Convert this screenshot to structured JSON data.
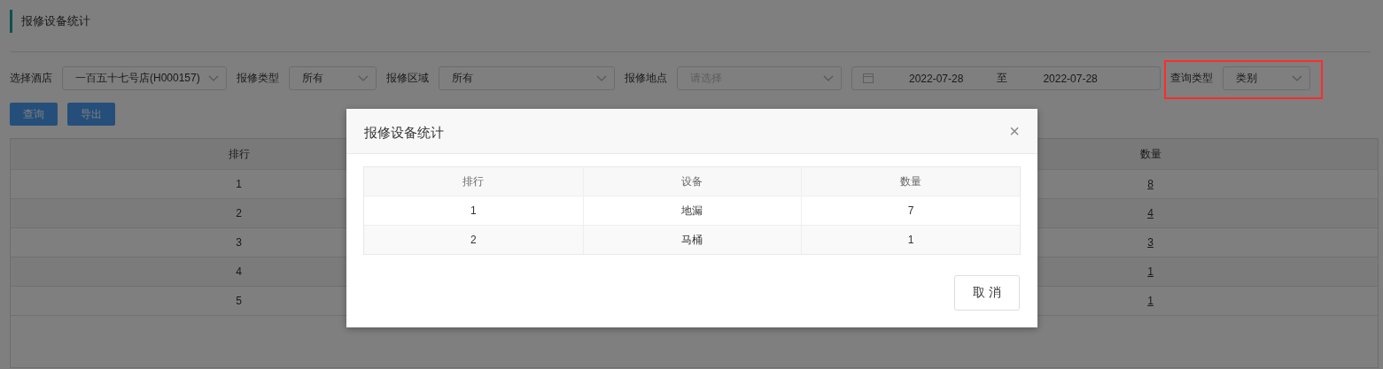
{
  "page": {
    "title": "报修设备统计"
  },
  "filters": [
    {
      "kind": "select",
      "label": "选择酒店",
      "value": "一百五十七号店(H000157)",
      "highlighted": false
    },
    {
      "kind": "select",
      "label": "报修类型",
      "value": "所有",
      "highlighted": false
    },
    {
      "kind": "select",
      "label": "报修区域",
      "value": "所有",
      "highlighted": false
    },
    {
      "kind": "select",
      "label": "报修地点",
      "placeholder": "请选择",
      "highlighted": false
    },
    {
      "kind": "daterange",
      "start": "2022-07-28",
      "separator": "至",
      "end": "2022-07-28",
      "highlighted": false
    },
    {
      "kind": "select",
      "label": "查询类型",
      "value": "类别",
      "highlighted": true
    }
  ],
  "buttons": [
    "查询",
    "导出"
  ],
  "table": {
    "columns": [
      "排行",
      "数量"
    ],
    "rows": [
      {
        "rank": "1",
        "count": "8"
      },
      {
        "rank": "2",
        "count": "4"
      },
      {
        "rank": "3",
        "count": "3"
      },
      {
        "rank": "4",
        "count": "1"
      },
      {
        "rank": "5",
        "count": "1"
      }
    ]
  },
  "dialog": {
    "title": "报修设备统计",
    "close": "×",
    "columns": [
      "排行",
      "设备",
      "数量"
    ],
    "rows": [
      [
        "1",
        "地漏",
        "7"
      ],
      [
        "2",
        "马桶",
        "1"
      ]
    ],
    "cancel": "取 消"
  }
}
